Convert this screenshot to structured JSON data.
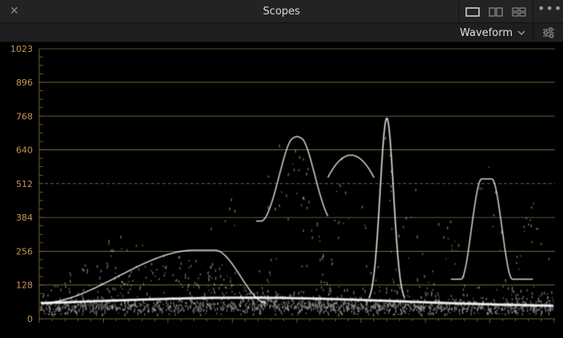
{
  "window": {
    "title": "Scopes"
  },
  "toolbar": {
    "mode": "Waveform"
  },
  "colors": {
    "grid": "#8a7344",
    "label": "#c09656",
    "trace": "#ffffff"
  },
  "icons": {
    "close": "close-icon",
    "layout1": "single-view-icon",
    "layout2": "dual-view-icon",
    "layout4": "quad-view-icon",
    "more": "more-icon",
    "dropdown": "chevron-down-icon",
    "settings": "sliders-icon"
  },
  "chart_data": {
    "type": "waveform",
    "ylim": [
      0,
      1023
    ],
    "yticks": [
      0,
      128,
      256,
      384,
      512,
      640,
      768,
      896,
      1023
    ],
    "y_tick_labels": [
      "0",
      "128",
      "256",
      "384",
      "512",
      "640",
      "768",
      "896",
      "1023"
    ],
    "dashed_line": 512,
    "grid": true
  }
}
